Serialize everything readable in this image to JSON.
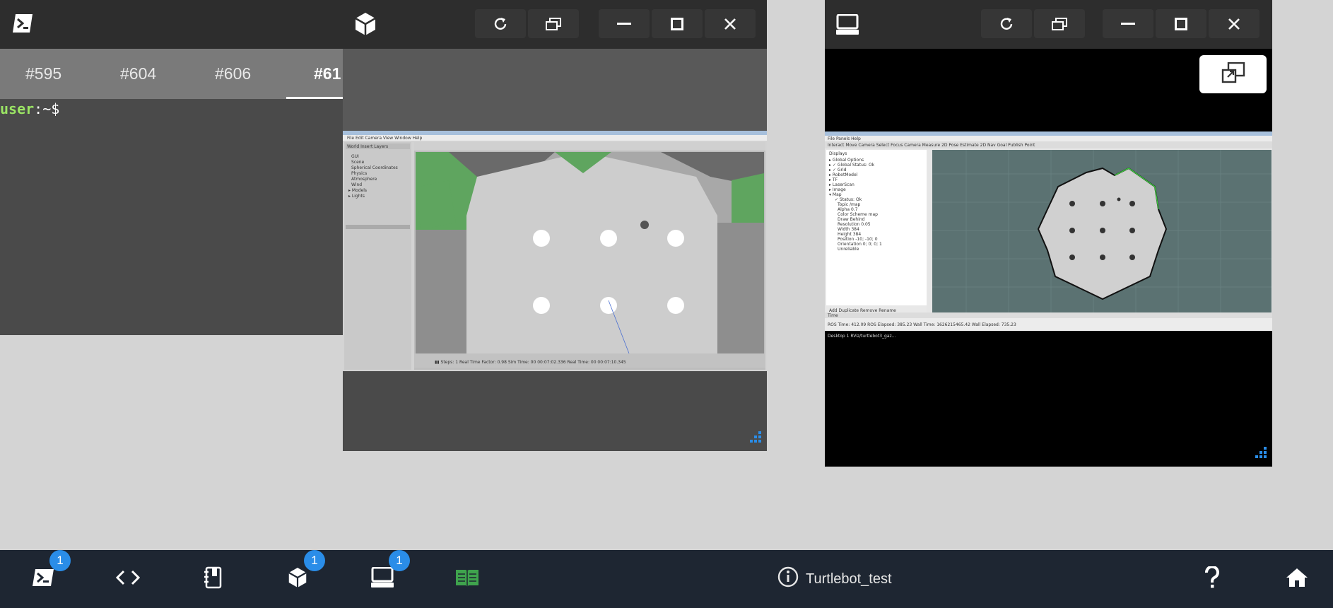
{
  "terminal": {
    "tabs": [
      "#595",
      "#604",
      "#606",
      "#61"
    ],
    "active_tab_index": 3,
    "prompt_user": "user",
    "prompt_rest": ":~$"
  },
  "taskbar": {
    "items": [
      {
        "name": "terminal",
        "badge": "1"
      },
      {
        "name": "code-editor",
        "badge": ""
      },
      {
        "name": "notebook",
        "badge": ""
      },
      {
        "name": "gazebo",
        "badge": "1"
      },
      {
        "name": "rviz-desktop",
        "badge": "1"
      },
      {
        "name": "book",
        "badge": ""
      }
    ],
    "project_name": "Turtlebot_test"
  },
  "colors": {
    "accent_blue": "#2a8de8",
    "taskbar_bg": "#1e2632",
    "book_green": "#3fa34d",
    "prompt_green": "#9be564"
  }
}
